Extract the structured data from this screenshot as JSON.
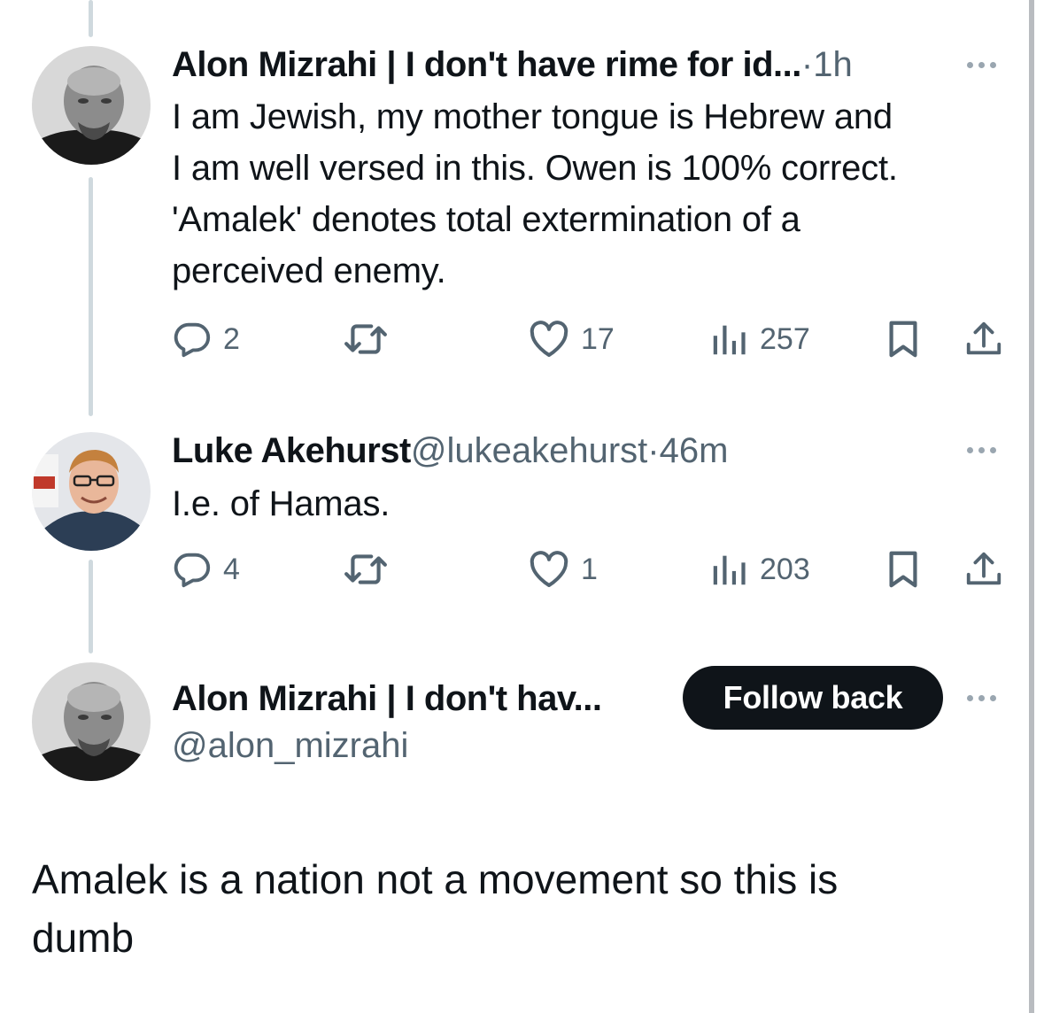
{
  "tweets": [
    {
      "name": "Alon Mizrahi | I don't have rime for id...",
      "sep": " · ",
      "time": "1h",
      "text": "I am Jewish, my mother tongue is Hebrew and\nI am well versed in this. Owen is 100% correct.\n'Amalek' denotes total extermination of a\nperceived enemy.",
      "replies": "2",
      "reposts": "",
      "likes": "17",
      "views": "257"
    },
    {
      "name": "Luke Akehurst",
      "handle": " @lukeakehurst",
      "sep": " · ",
      "time": "46m",
      "text": "I.e. of Hamas.",
      "replies": "4",
      "reposts": "",
      "likes": "1",
      "views": "203"
    }
  ],
  "main_tweet": {
    "name": "Alon Mizrahi | I don't hav...",
    "handle": "@alon_mizrahi",
    "follow_label": "Follow back",
    "text": "Amalek is a nation not a movement so this is\ndumb"
  },
  "icons": [
    "reply-icon",
    "repost-icon",
    "like-icon",
    "views-icon",
    "bookmark-icon",
    "share-icon",
    "more-icon"
  ],
  "colors": {
    "text": "#0f1419",
    "secondary": "#536471",
    "thread_line": "#cfd9de",
    "button_bg": "#0f1419"
  }
}
